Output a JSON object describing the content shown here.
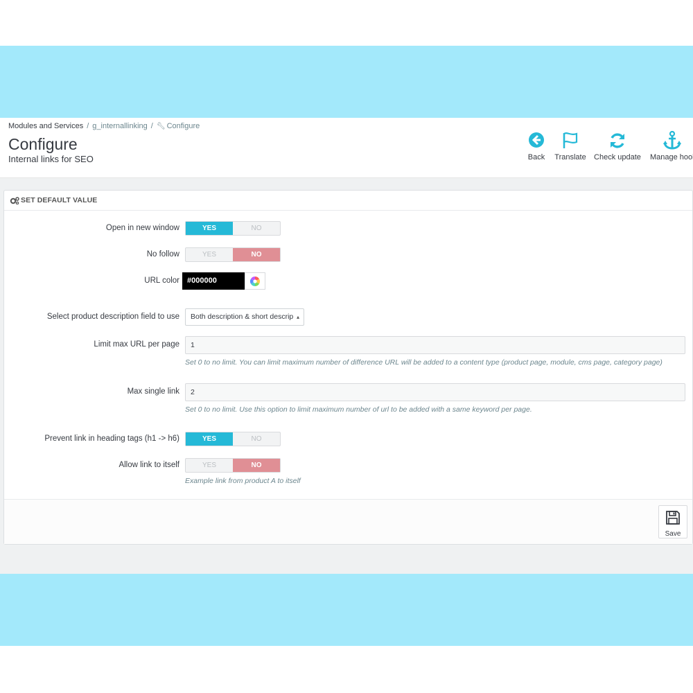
{
  "breadcrumb": {
    "items": [
      "Modules and Services",
      "g_internallinking",
      "Configure"
    ],
    "separator": "/"
  },
  "header": {
    "title": "Configure",
    "subtitle": "Internal links for SEO"
  },
  "toolbar": {
    "back_label": "Back",
    "translate_label": "Translate",
    "check_update_label": "Check update",
    "manage_hooks_label": "Manage hool"
  },
  "panel": {
    "heading": "SET DEFAULT VALUE",
    "fields": {
      "open_new_window": {
        "label": "Open in new window",
        "yes": "YES",
        "no": "NO",
        "value": "YES"
      },
      "no_follow": {
        "label": "No follow",
        "yes": "YES",
        "no": "NO",
        "value": "NO"
      },
      "url_color": {
        "label": "URL color",
        "value": "#000000"
      },
      "product_desc_field": {
        "label": "Select product description field to use",
        "selected": "Both description & short descrip"
      },
      "limit_max_url": {
        "label": "Limit max URL per page",
        "value": "1",
        "help": "Set 0 to no limit. You can limit maximum number of difference URL will be added to a content type (product page, module, cms page, category page)"
      },
      "max_single_link": {
        "label": "Max single link",
        "value": "2",
        "help": "Set 0 to no limit. Use this option to limit maximum number of url to be added with a same keyword per page."
      },
      "prevent_heading": {
        "label": "Prevent link in heading tags (h1 -> h6)",
        "yes": "YES",
        "no": "NO",
        "value": "YES"
      },
      "allow_self": {
        "label": "Allow link to itself",
        "yes": "YES",
        "no": "NO",
        "value": "NO",
        "help": "Example link from product A to itself"
      }
    },
    "save_label": "Save"
  },
  "colors": {
    "accent": "#25b9d7",
    "no_active": "#e08f95",
    "band": "#a3e9fb"
  }
}
